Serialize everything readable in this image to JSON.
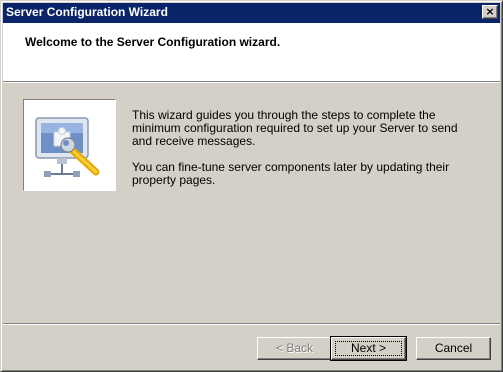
{
  "window": {
    "title": "Server Configuration Wizard",
    "close_glyph": "×"
  },
  "header": {
    "title": "Welcome to the Server Configuration wizard."
  },
  "image": {
    "icon": "server-config-icon"
  },
  "body": {
    "paragraph1": "This wizard guides you through the steps to complete the minimum configuration required to set up your Server to send and receive messages.",
    "paragraph2": "You can fine-tune server components later by updating their property pages."
  },
  "buttons": {
    "back": "< Back",
    "next": "Next >",
    "cancel": "Cancel"
  },
  "colors": {
    "titlebar": "#0a246a",
    "dialog_face": "#d4d0c8",
    "header_bg": "#ffffff"
  }
}
